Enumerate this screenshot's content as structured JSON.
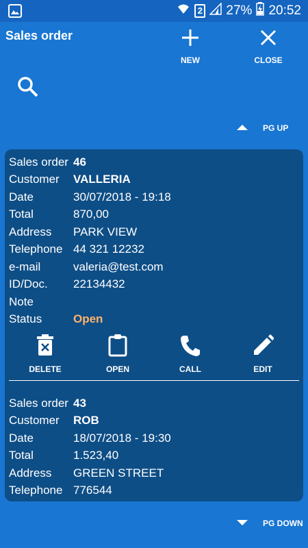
{
  "status_bar": {
    "battery": "27%",
    "time": "20:52",
    "sim": "2"
  },
  "header": {
    "title": "Sales order",
    "new_label": "NEW",
    "close_label": "CLOSE",
    "pg_up_label": "PG UP",
    "pg_down_label": "PG DOWN"
  },
  "field_labels": {
    "sales_order": "Sales order",
    "customer": "Customer",
    "date": "Date",
    "total": "Total",
    "address": "Address",
    "telephone": "Telephone",
    "email": "e-mail",
    "id_doc": "ID/Doc.",
    "note": "Note",
    "status": "Status"
  },
  "actions": {
    "delete": "DELETE",
    "open": "OPEN",
    "call": "CALL",
    "edit": "EDIT"
  },
  "orders": [
    {
      "number": "46",
      "customer": "VALLERIA",
      "date": "30/07/2018 - 19:18",
      "total": "870,00",
      "address": "PARK VIEW",
      "telephone": "44 321 12232",
      "email": "valeria@test.com",
      "id_doc": "22134432",
      "note": "",
      "status": "Open"
    },
    {
      "number": "43",
      "customer": "ROB",
      "date": "18/07/2018 - 19:30",
      "total": "1.523,40",
      "address": "GREEN STREET",
      "telephone": "776544"
    }
  ],
  "colors": {
    "background": "#1976D2",
    "panel": "#0E4E86",
    "status_open": "#FFB26B"
  }
}
